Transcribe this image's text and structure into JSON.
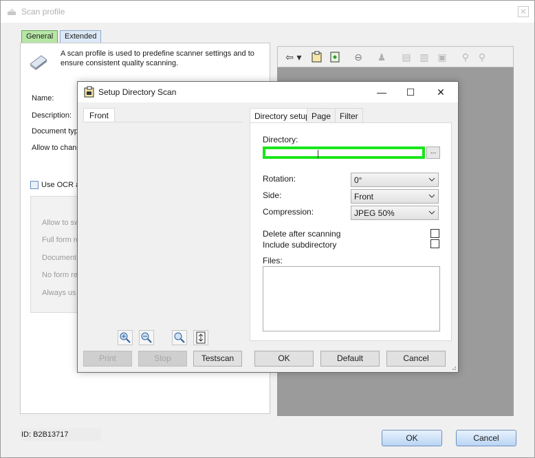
{
  "outer": {
    "title": "Scan profile",
    "tabs": [
      {
        "label": "General"
      },
      {
        "label": "Extended"
      }
    ],
    "intro": "A scan profile is used to predefine scanner settings and to ensure consistent quality scanning.",
    "labels": {
      "name": "Name:",
      "description": "Description:",
      "document_type": "Document typ",
      "allow_change": "Allow to chang",
      "use_ocr": "Use OCR ar"
    },
    "gray_labels": [
      "Allow to sw",
      "Full form re",
      "Document t",
      "No form rec",
      "Always us"
    ],
    "id_text": "ID: B2B13717",
    "ok_label": "OK",
    "cancel_label": "Cancel"
  },
  "dialog": {
    "title": "Setup Directory Scan",
    "left_tab": "Front",
    "tabs": [
      {
        "label": "Directory setup"
      },
      {
        "label": "Page"
      },
      {
        "label": "Filter"
      }
    ],
    "directory_label": "Directory:",
    "directory_value": "",
    "browse_label": "...",
    "rotation_label": "Rotation:",
    "rotation_value": "0°",
    "side_label": "Side:",
    "side_value": "Front",
    "compression_label": "Compression:",
    "compression_value": "JPEG 50%",
    "delete_after_label": "Delete after scanning",
    "delete_after_checked": false,
    "include_sub_label": "Include subdirectory",
    "include_sub_checked": false,
    "files_label": "Files:",
    "buttons": {
      "print": "Print",
      "stop": "Stop",
      "testscan": "Testscan",
      "ok": "OK",
      "default": "Default",
      "cancel": "Cancel"
    }
  },
  "colors": {
    "highlight": "#19e619",
    "preview_bg": "#9b9b9b",
    "general_tab": "#b7e6a6"
  }
}
